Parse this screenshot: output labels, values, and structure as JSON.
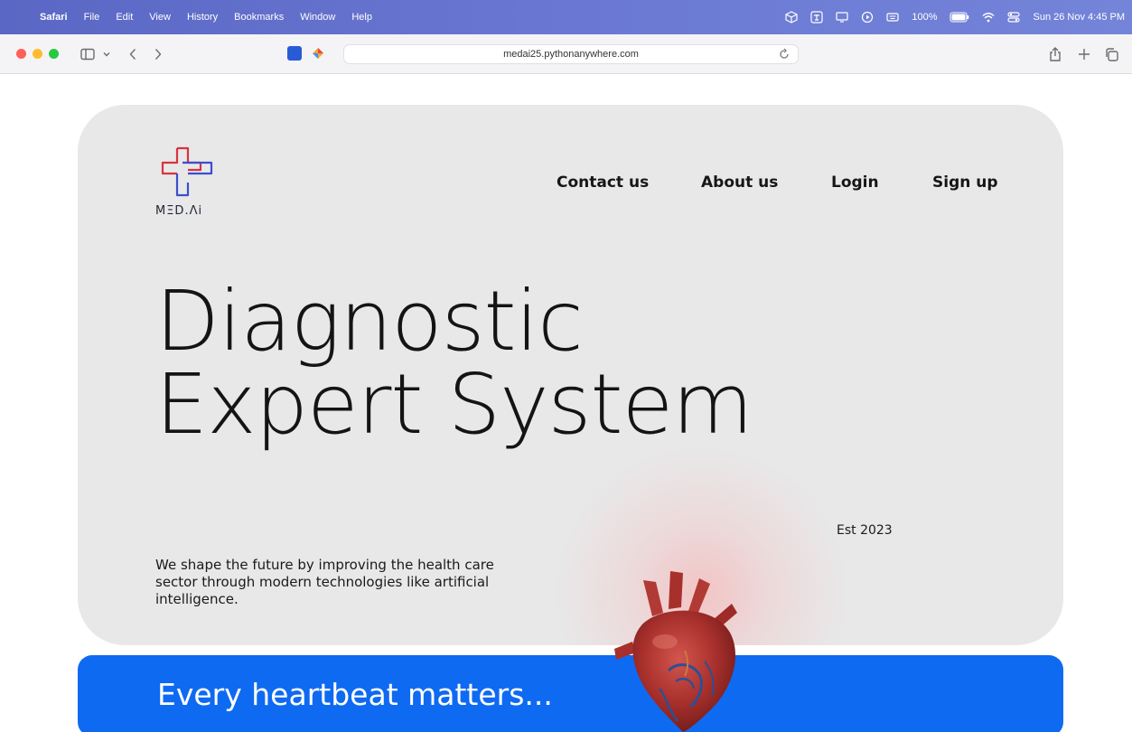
{
  "menubar": {
    "app_name": "Safari",
    "items": [
      "File",
      "Edit",
      "View",
      "History",
      "Bookmarks",
      "Window",
      "Help"
    ],
    "battery": "100%",
    "clock": "Sun 26 Nov  4:45 PM"
  },
  "browser": {
    "url": "medai25.pythonanywhere.com"
  },
  "site": {
    "logo_text": "MΞD.Λi",
    "nav": {
      "contact": "Contact us",
      "about": "About us",
      "login": "Login",
      "signup": "Sign up"
    },
    "headline_line1": "Diagnostic",
    "headline_line2": "Expert System",
    "est": "Est 2023",
    "tagline": "We shape the future by improving the health care sector through modern technologies like artificial intelligence.",
    "banner": "Every heartbeat matters..."
  },
  "colors": {
    "accent_blue": "#0f6af2",
    "hero_bg": "#e8e8e9",
    "logo_red": "#d9333f",
    "logo_blue": "#3b4fcf"
  }
}
